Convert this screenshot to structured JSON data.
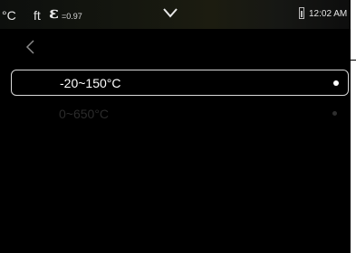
{
  "status_bar": {
    "temperature_unit": "°C",
    "distance_unit": "ft",
    "emissivity_symbol": "ε",
    "emissivity_value": "=0.97",
    "dropdown_icon": "chevron-down-icon",
    "battery_icon": "battery-icon",
    "time": "12:02 AM"
  },
  "navigation": {
    "back_icon": "chevron-left-icon"
  },
  "range_options": [
    {
      "label": "-20~150°C",
      "selected": true
    },
    {
      "label": "0~650°C",
      "selected": false
    }
  ],
  "colors": {
    "background": "#000000",
    "selected_text": "#ffffff",
    "unselected_text": "#2b2b2b",
    "selection_border": "#d9d9d9"
  }
}
